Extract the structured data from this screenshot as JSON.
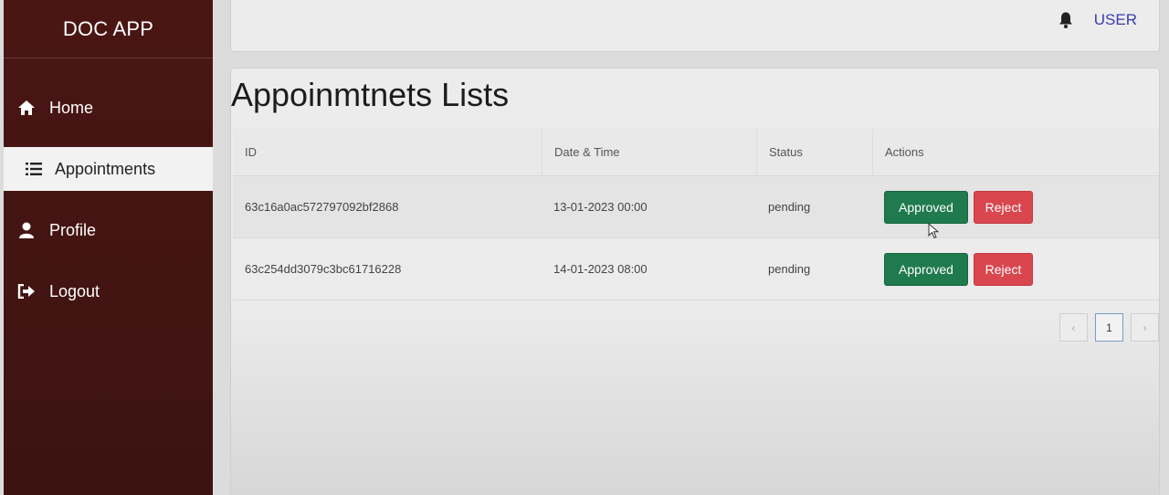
{
  "app": {
    "brand": "DOC APP"
  },
  "sidebar": {
    "items": [
      {
        "label": "Home",
        "icon": "home-icon",
        "active": false
      },
      {
        "label": "Appointments",
        "icon": "list-icon",
        "active": true
      },
      {
        "label": "Profile",
        "icon": "user-icon",
        "active": false
      },
      {
        "label": "Logout",
        "icon": "logout-icon",
        "active": false
      }
    ]
  },
  "header": {
    "bell_icon": "bell-icon",
    "user_label": "USER"
  },
  "main": {
    "title": "Appoinmtnets Lists",
    "columns": [
      "ID",
      "Date & Time",
      "Status",
      "Actions"
    ],
    "rows": [
      {
        "id": "63c16a0ac572797092bf2868",
        "datetime": "13-01-2023  00:00",
        "status": "pending",
        "approve_label": "Approved",
        "reject_label": "Reject"
      },
      {
        "id": "63c254dd3079c3bc61716228",
        "datetime": "14-01-2023  08:00",
        "status": "pending",
        "approve_label": "Approved",
        "reject_label": "Reject"
      }
    ],
    "pagination": {
      "prev": "‹",
      "current": "1",
      "next": "›"
    }
  },
  "colors": {
    "sidebar": "#4a1614",
    "approve": "#1f7a4e",
    "reject": "#d9464e",
    "user_link": "#3b3bb0"
  }
}
